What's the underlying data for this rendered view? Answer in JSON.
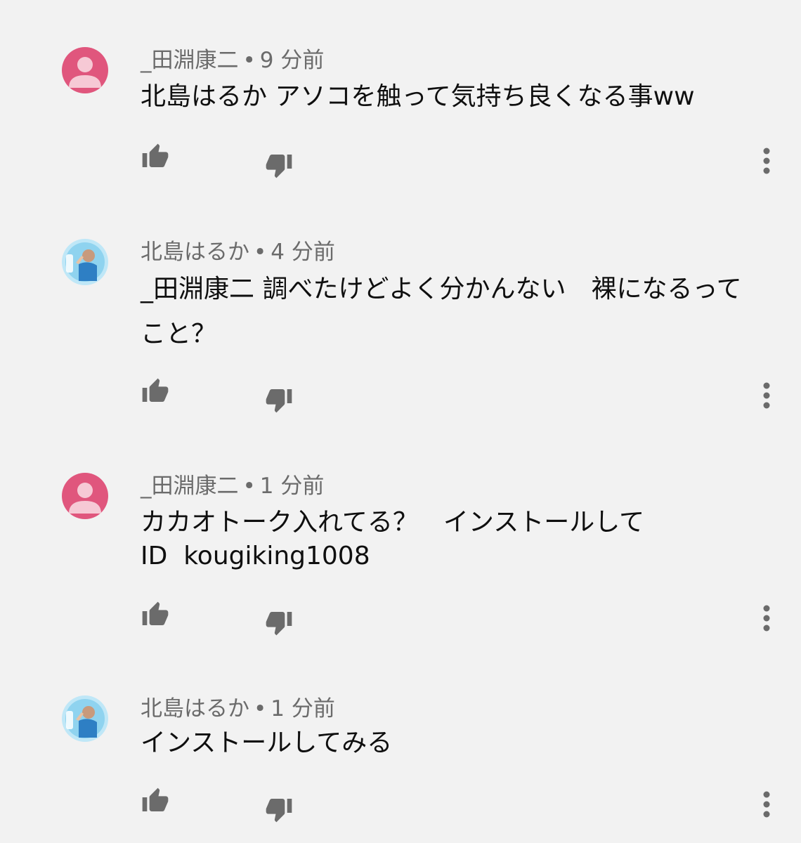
{
  "colors": {
    "background": "#f2f2f2",
    "meta_text": "#6b6b6b",
    "body_text": "#0f0f0f",
    "icon": "#6b6b6b",
    "default_avatar_bg": "#e0567d",
    "default_avatar_fg": "#f6c9d5"
  },
  "icons": {
    "like": "thumbs-up-icon",
    "dislike": "thumbs-down-icon",
    "more": "more-vert-icon",
    "default_avatar": "person-icon"
  },
  "comments": [
    {
      "author": "_田淵康二",
      "separator": "•",
      "time": "9 分前",
      "text": "北島はるか アソコを触って気持ち良くなる事ww",
      "avatar": "default-pink"
    },
    {
      "author": "北島はるか",
      "separator": "•",
      "time": "4 分前",
      "text": "_田淵康二 調べたけどよく分かんない　裸になるってこと？",
      "avatar": "photo"
    },
    {
      "author": "_田淵康二",
      "separator": "•",
      "time": "1 分前",
      "text": "カカオトーク入れてる？　インストールして\nID  kougiking1008",
      "avatar": "default-pink"
    },
    {
      "author": "北島はるか",
      "separator": "•",
      "time": "1 分前",
      "text": "インストールしてみる",
      "avatar": "photo"
    }
  ]
}
